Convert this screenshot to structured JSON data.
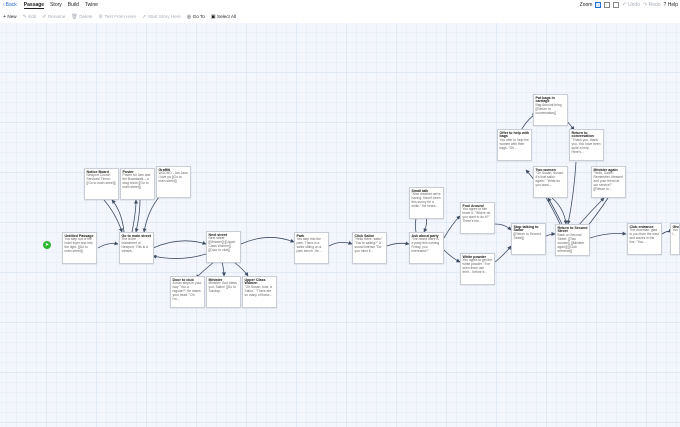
{
  "topbar": {
    "back_label": "Back",
    "tabs": [
      "Passage",
      "Story",
      "Build",
      "Twine"
    ],
    "zoom_label": "Zoom",
    "undo_label": "Undo",
    "redo_label": "Redo",
    "help_label": "Help"
  },
  "toolbar": {
    "new_label": "New",
    "edit_label": "Edit",
    "rename_label": "Rename",
    "delete_label": "Delete",
    "test_label": "Test From Here",
    "start_label": "Start Story Here",
    "goto_label": "Go To",
    "select_all_label": "Select All"
  },
  "passages": [
    {
      "id": "untitled",
      "title": "Untitled Passage",
      "excerpt": "You step out of the hotel foyer and into the light. [[Go to main street]]"
    },
    {
      "id": "notice",
      "title": "Notice Board",
      "excerpt": "Newport Church Services! Times: [[Go to main street]]"
    },
    {
      "id": "poster",
      "title": "Poster",
      "excerpt": "Poster for Jam and the Boardwalk – a drag show [[Go to main street]]"
    },
    {
      "id": "graffiti",
      "title": "Graffiti",
      "excerpt": "WOOHO – lan Jane I love ya [[Go to main street]]"
    },
    {
      "id": "mainstreet",
      "title": "Go to main street",
      "excerpt": "The is the mainstreet of Newport. This is a vibrant..."
    },
    {
      "id": "nextstreet",
      "title": "Next street",
      "excerpt": "Next street [[Minister]] [[Upper Class Women]] [[Door to club]]"
    },
    {
      "id": "door",
      "title": "Door to club",
      "excerpt": "A man steps in your way \"You a regular?\" He raises your head. \"Oh I'm..."
    },
    {
      "id": "minister",
      "title": "Minister",
      "excerpt": "Minister: God bless you, Sailor! [[Go to Sunday..."
    },
    {
      "id": "upperclass",
      "title": "Upper Class Women",
      "excerpt": "\"Oh Susan, look, a Sailor.\" \"There are so many of those..."
    },
    {
      "id": "park",
      "title": "Park",
      "excerpt": "You step into the park. There is a sailor sitting on a park bench. He..."
    },
    {
      "id": "clicksailor",
      "title": "Click Sailor",
      "excerpt": "\"Hello there, sailor\" \"You're sailing?\" A sound intense \"Do you mind if..."
    },
    {
      "id": "smalltalk",
      "title": "Small talk",
      "excerpt": "\"Nice weather we're having. Hasn't been this sunny for a while.\" He hears..."
    },
    {
      "id": "askparty",
      "title": "Ask about party",
      "excerpt": "\"I've heard there is a party this coming Friday, you interested?\""
    },
    {
      "id": "fool",
      "title": "Fool Around",
      "excerpt": "You agree to him leave it. \"Where do you want to do it?\" There's the..."
    },
    {
      "id": "powder",
      "title": "White powder",
      "excerpt": "You agree to get the white powder. \"I've seen them use their... before it..."
    },
    {
      "id": "stoptalk",
      "title": "Stop talking to Sailor",
      "excerpt": "[[Return to Second Street]]"
    },
    {
      "id": "offerbags",
      "title": "Offer to help with bags",
      "excerpt": "You offer to help the women with their bags. \"Oh..."
    },
    {
      "id": "putbags",
      "title": "Put bags in carriage",
      "excerpt": "Bag Amount thing [[Return to conversation]]"
    },
    {
      "id": "returnconv",
      "title": "Return to conversation",
      "excerpt": "\"Thank you, thank you. You have been quite a help. Here's..."
    },
    {
      "id": "twowomen",
      "title": "Two women",
      "excerpt": "\"Oh Susan, Susan! It's that sailor again.\" \"What do you want..."
    },
    {
      "id": "ministeragain",
      "title": "Minister again",
      "excerpt": "\"Hello, Sailor! Remember, blessed and your friend at our service!\" [[Return to..."
    },
    {
      "id": "returnsecond",
      "title": "Return to Second Street",
      "excerpt": "Back on Second Street. [[Two women]] [[Minister again]] [[Club entrance]]"
    },
    {
      "id": "clubentrance",
      "title": "Club entrance",
      "excerpt": "The doorman, glad to you from the east and waves in the line. \"You..."
    },
    {
      "id": "give",
      "title": "Give",
      "excerpt": "You i..."
    }
  ],
  "colors": {
    "accent": "#1f6fd6",
    "start": "#2eb82e",
    "link": "#3f4d63"
  }
}
